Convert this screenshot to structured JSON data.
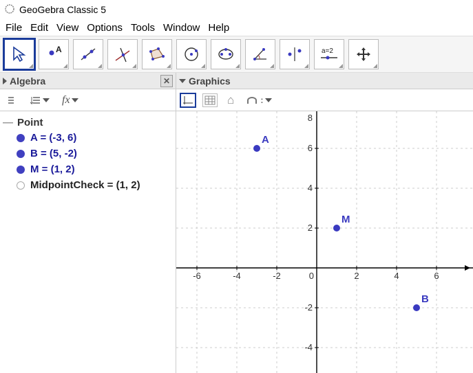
{
  "app": {
    "title": "GeoGebra Classic 5"
  },
  "menu": {
    "file": "File",
    "edit": "Edit",
    "view": "View",
    "options": "Options",
    "tools": "Tools",
    "window": "Window",
    "help": "Help"
  },
  "tools": {
    "slider_label": "a=2"
  },
  "panels": {
    "algebra": {
      "title": "Algebra",
      "fx": "fх",
      "group": "Point",
      "items": [
        {
          "label": "A = (-3, 6)",
          "filled": true
        },
        {
          "label": "B = (5, -2)",
          "filled": true
        },
        {
          "label": "M = (1, 2)",
          "filled": true
        },
        {
          "label": "MidpointCheck = (1, 2)",
          "filled": false
        }
      ]
    },
    "graphics": {
      "title": "Graphics",
      "ticks_x": [
        "-6",
        "-4",
        "-2",
        "0",
        "2",
        "4",
        "6"
      ],
      "ticks_y": [
        "-4",
        "-2",
        "2",
        "4",
        "6",
        "8"
      ],
      "points": {
        "A": {
          "label": "A",
          "x": -3,
          "y": 6
        },
        "B": {
          "label": "B",
          "x": 5,
          "y": -2
        },
        "M": {
          "label": "M",
          "x": 1,
          "y": 2
        }
      }
    }
  },
  "chart_data": {
    "type": "scatter",
    "title": "",
    "xlabel": "",
    "ylabel": "",
    "xlim": [
      -7,
      7
    ],
    "ylim": [
      -5,
      9
    ],
    "series": [
      {
        "name": "A",
        "x": [
          -3
        ],
        "y": [
          6
        ]
      },
      {
        "name": "B",
        "x": [
          5
        ],
        "y": [
          -2
        ]
      },
      {
        "name": "M",
        "x": [
          1
        ],
        "y": [
          2
        ]
      }
    ]
  }
}
